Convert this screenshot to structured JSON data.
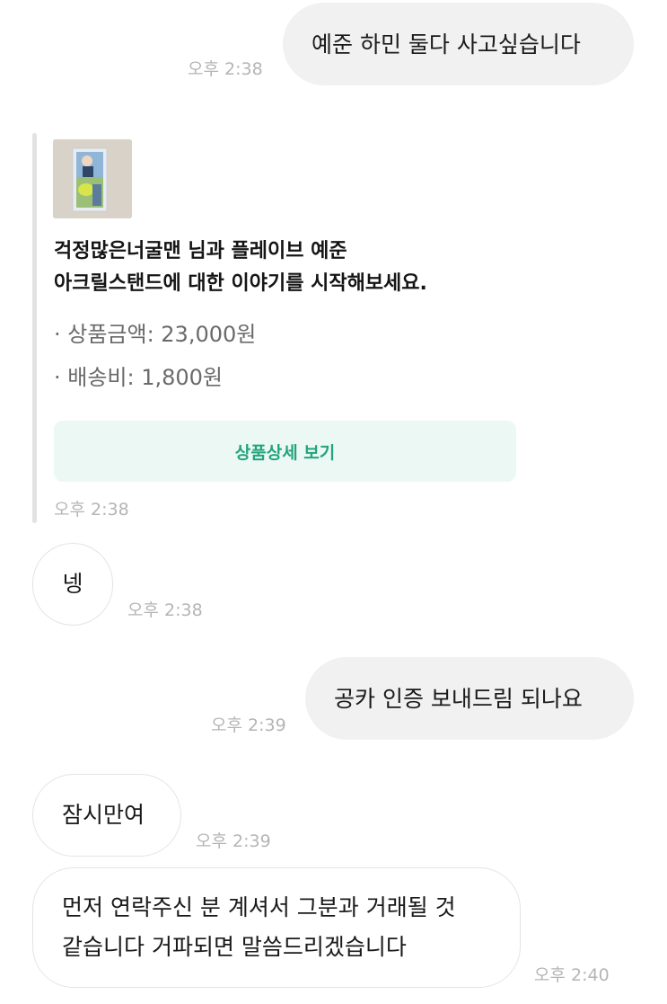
{
  "messages": {
    "m1": {
      "text": "예준 하민 둘다 사고싶습니다",
      "time": "오후 2:38"
    },
    "card": {
      "title_line1": "걱정많은너굴맨 님과 플레이브 예준",
      "title_line2": "아크릴스탠드에 대한 이야기를 시작해보세요.",
      "price": "· 상품금액: 23,000원",
      "shipping": "· 배송비: 1,800원",
      "button": "상품상세 보기",
      "time": "오후 2:38"
    },
    "m2": {
      "text": "넹",
      "time": "오후 2:38"
    },
    "m3": {
      "text": "공카 인증 보내드림 되나요",
      "time": "오후 2:39"
    },
    "m4": {
      "text": "잠시만여",
      "time": "오후 2:39"
    },
    "m5": {
      "line1": "먼저 연락주신 분 계셔서 그분과 거래될 것",
      "line2": "같습니다 거파되면 말씀드리겠습니다",
      "time": "오후 2:40"
    }
  },
  "colors": {
    "sent_bubble": "#f1f1f1",
    "received_border": "#e4e4e4",
    "timestamp": "#b5b5b5",
    "accent_green": "#23a47d",
    "button_bg": "#ecf8f4"
  }
}
